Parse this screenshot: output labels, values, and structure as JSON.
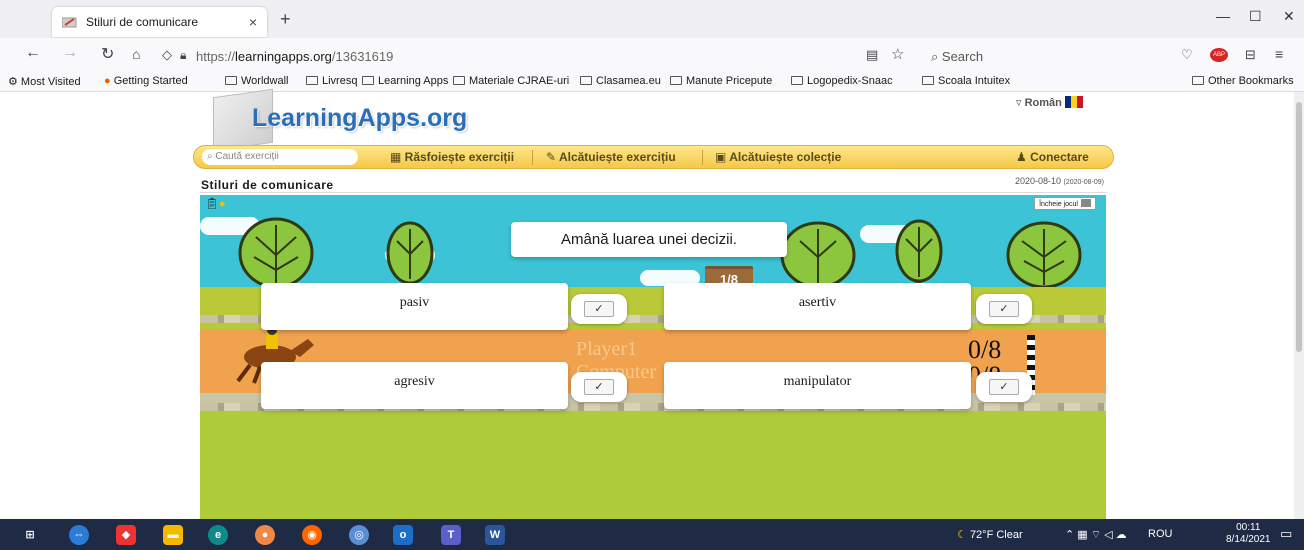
{
  "browser": {
    "tab_title": "Stiluri de comunicare",
    "tab_close": "×",
    "new_tab": "+",
    "url_prefix": "https://",
    "url_main": "learningapps.org",
    "url_path": "/13631619",
    "search_placeholder": "Search",
    "bookmarks": [
      "Most Visited",
      "Getting Started",
      "Worldwall",
      "Livresq",
      "Learning Apps",
      "Materiale CJRAE-uri",
      "Clasamea.eu",
      "Manute Pricepute",
      "Logopedix-Snaac",
      "Scoala Intuitex"
    ],
    "other_bookmarks": "Other Bookmarks"
  },
  "site": {
    "logo": "LearningApps.org",
    "language": "Român",
    "search_placeholder": "Caută exerciții",
    "menu": [
      "Răsfoiește exerciții",
      "Alcătuiește exercițiu",
      "Alcătuiește colecție",
      "Conectare"
    ],
    "page_title": "Stiluri de comunicare",
    "date": "2020-08-10",
    "date_small": "(2020-08-09)"
  },
  "game": {
    "question": "Amână luarea unei decizii.",
    "progress": "1/8",
    "fullscreen_label": "Încheie jocul",
    "answers": [
      "pasiv",
      "asertiv",
      "agresiv",
      "manipulator"
    ],
    "check_mark": "✓",
    "player1": "Player1",
    "player2": "Computer",
    "score1": "0/8",
    "score2": "0/8"
  },
  "taskbar": {
    "weather": "72°F  Clear",
    "lang": "ROU",
    "time": "00:11",
    "date": "8/14/2021"
  }
}
